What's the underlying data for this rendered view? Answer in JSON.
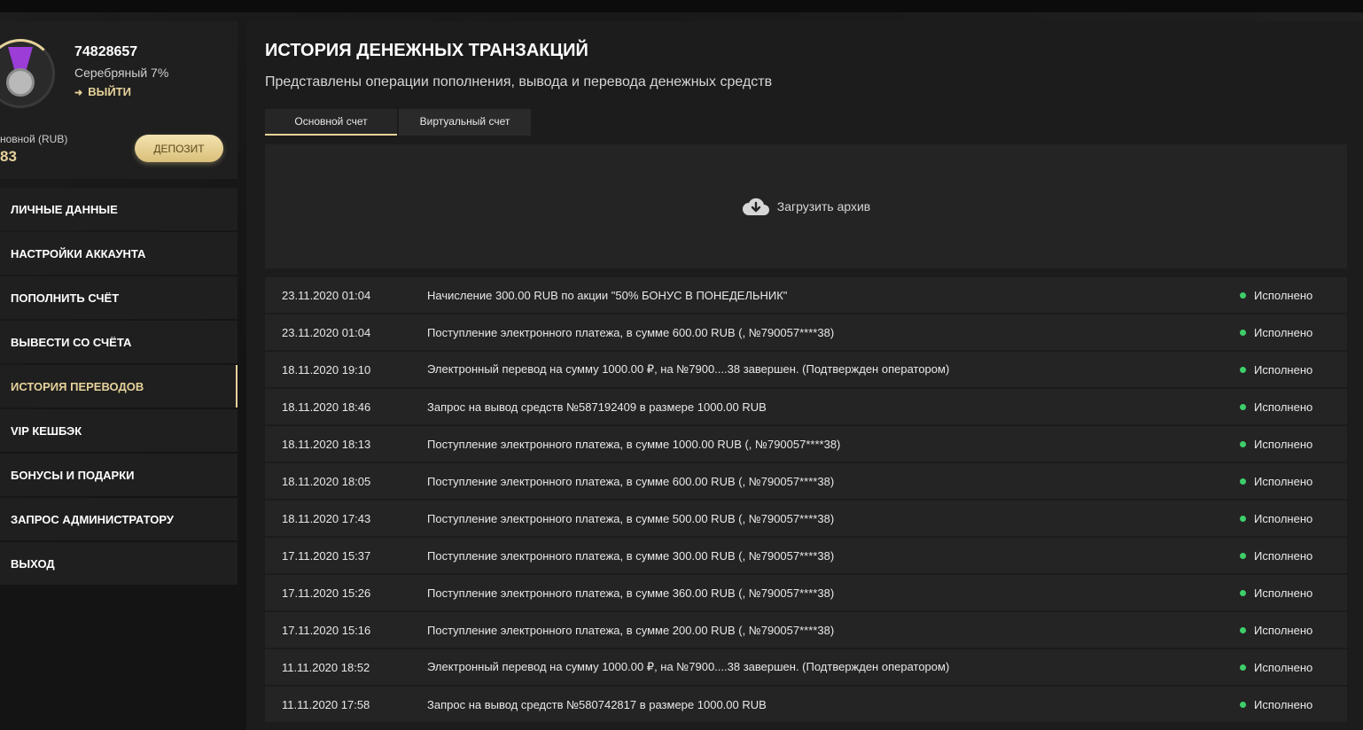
{
  "profile": {
    "user_id": "74828657",
    "rank": "Серебряный 7%",
    "logout_label": "ВЫЙТИ",
    "account_label": "новной (RUB)",
    "balance": "83",
    "deposit_label": "ДЕПОЗИТ"
  },
  "menu": [
    {
      "label": "ЛИЧНЫЕ ДАННЫЕ",
      "active": false
    },
    {
      "label": "НАСТРОЙКИ АККАУНТА",
      "active": false
    },
    {
      "label": "ПОПОЛНИТЬ СЧЁТ",
      "active": false
    },
    {
      "label": "ВЫВЕСТИ СО СЧЁТА",
      "active": false
    },
    {
      "label": "ИСТОРИЯ ПЕРЕВОДОВ",
      "active": true
    },
    {
      "label": "VIP КЕШБЭК",
      "active": false
    },
    {
      "label": "БОНУСЫ И ПОДАРКИ",
      "active": false
    },
    {
      "label": "ЗАПРОС АДМИНИСТРАТОРУ",
      "active": false
    },
    {
      "label": "ВЫХОД",
      "active": false
    }
  ],
  "main": {
    "title": "ИСТОРИЯ ДЕНЕЖНЫХ ТРАНЗАКЦИЙ",
    "subtitle": "Представлены операции пополнения, вывода и перевода денежных средств",
    "tabs": [
      {
        "label": "Основной счет",
        "active": true
      },
      {
        "label": "Виртуальный счет",
        "active": false
      }
    ],
    "archive_label": "Загрузить архив",
    "transactions": [
      {
        "date": "23.11.2020 01:04",
        "desc": "Начисление 300.00 RUB по акции \"50% БОНУС В ПОНЕДЕЛЬНИК\"",
        "status": "Исполнено"
      },
      {
        "date": "23.11.2020 01:04",
        "desc": "Поступление электронного платежа, в сумме 600.00 RUB (, №790057****38)",
        "status": "Исполнено"
      },
      {
        "date": "18.11.2020 19:10",
        "desc": "Электронный перевод на сумму 1000.00 ₽, на №7900....38 завершен. (Подтвержден оператором)",
        "status": "Исполнено"
      },
      {
        "date": "18.11.2020 18:46",
        "desc": "Запрос на вывод средств №587192409 в размере 1000.00 RUB",
        "status": "Исполнено"
      },
      {
        "date": "18.11.2020 18:13",
        "desc": "Поступление электронного платежа, в сумме 1000.00 RUB (, №790057****38)",
        "status": "Исполнено"
      },
      {
        "date": "18.11.2020 18:05",
        "desc": "Поступление электронного платежа, в сумме 600.00 RUB (, №790057****38)",
        "status": "Исполнено"
      },
      {
        "date": "18.11.2020 17:43",
        "desc": "Поступление электронного платежа, в сумме 500.00 RUB (, №790057****38)",
        "status": "Исполнено"
      },
      {
        "date": "17.11.2020 15:37",
        "desc": "Поступление электронного платежа, в сумме 300.00 RUB (, №790057****38)",
        "status": "Исполнено"
      },
      {
        "date": "17.11.2020 15:26",
        "desc": "Поступление электронного платежа, в сумме 360.00 RUB (, №790057****38)",
        "status": "Исполнено"
      },
      {
        "date": "17.11.2020 15:16",
        "desc": "Поступление электронного платежа, в сумме 200.00 RUB (, №790057****38)",
        "status": "Исполнено"
      },
      {
        "date": "11.11.2020 18:52",
        "desc": "Электронный перевод на сумму 1000.00 ₽, на №7900....38 завершен. (Подтвержден оператором)",
        "status": "Исполнено"
      },
      {
        "date": "11.11.2020 17:58",
        "desc": "Запрос на вывод средств №580742817 в размере 1000.00 RUB",
        "status": "Исполнено"
      }
    ]
  },
  "icons": {
    "avatar": "medal-icon",
    "logout": "logout-icon",
    "archive": "cloud-download-icon",
    "status": "status-dot-icon"
  },
  "colors": {
    "accent": "#e6d29a",
    "status_ok": "#3ecf6a",
    "panel": "#1f1f1f",
    "row": "#242424"
  }
}
